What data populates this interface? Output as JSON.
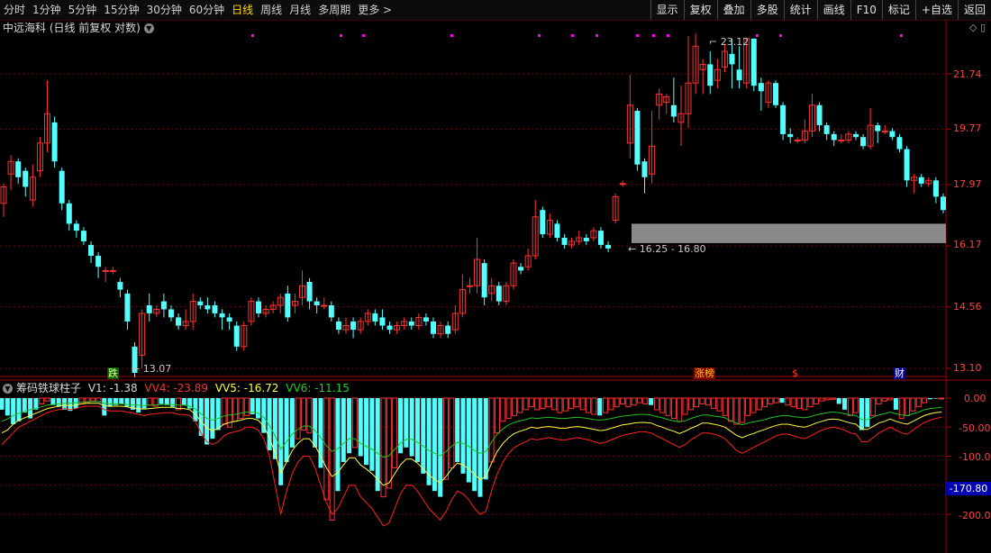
{
  "toolbar": {
    "left": [
      "分时",
      "1分钟",
      "5分钟",
      "15分钟",
      "30分钟",
      "60分钟",
      "日线",
      "周线",
      "月线",
      "多周期",
      "更多 >"
    ],
    "active_index": 6,
    "right": [
      "显示",
      "复权",
      "叠加",
      "多股",
      "统计",
      "画线",
      "F10",
      "标记",
      "+自选",
      "返回"
    ]
  },
  "header": {
    "title": "中远海科 (日线 前复权 对数)",
    "icons": "◇ ▯"
  },
  "price_axis": {
    "labels": [
      "21.74",
      "19.77",
      "17.97",
      "16.17",
      "14.56",
      "13.10"
    ]
  },
  "annotations": {
    "high": "23.12",
    "low": "13.07",
    "gap_zone": "16.25 - 16.80"
  },
  "markers": {
    "die": "跌",
    "zhangbang": "涨榜",
    "dollar": "$",
    "cai": "财"
  },
  "indicator": {
    "name": "筹码铁球柱子",
    "v1": "V1: -1.38",
    "vv4": "VV4: -23.89",
    "vv5": "VV5: -16.72",
    "vv6": "VV6: -11.15",
    "axis_labels": [
      "0.00",
      "-50.00",
      "-100.0",
      "-150.0",
      "-200.0"
    ],
    "current_badge": "-170.80"
  },
  "colors": {
    "up": "#ff3232",
    "down": "#54ffff",
    "grid": "#7a0000",
    "line_red": "#ff2020",
    "line_yellow": "#ffff40",
    "line_green": "#20c020",
    "marker_magenta": "#ff00ff"
  },
  "candles": [
    [
      17.4,
      17.9,
      17.1,
      18.0,
      17.0
    ],
    [
      18.3,
      18.7,
      18.0,
      18.9,
      17.8
    ],
    [
      18.7,
      18.2,
      18.1,
      18.8,
      18.0
    ],
    [
      18.4,
      17.9,
      17.7,
      18.5,
      17.6
    ],
    [
      17.5,
      18.2,
      17.4,
      18.6,
      17.3
    ],
    [
      18.4,
      19.3,
      18.3,
      19.5,
      18.2
    ],
    [
      19.3,
      20.3,
      19.2,
      21.5,
      19.0
    ],
    [
      20.0,
      18.7,
      18.6,
      20.2,
      18.5
    ],
    [
      18.4,
      17.4,
      17.3,
      18.5,
      17.2
    ],
    [
      17.4,
      16.8,
      16.7,
      17.5,
      16.6
    ],
    [
      16.8,
      16.6,
      16.5,
      16.9,
      16.4
    ],
    [
      16.6,
      16.3,
      16.2,
      16.7,
      16.2
    ],
    [
      16.2,
      15.9,
      15.8,
      16.3,
      15.7
    ],
    [
      15.9,
      15.6,
      15.5,
      16.0,
      15.3
    ],
    [
      15.5,
      15.5,
      15.4,
      15.6,
      15.2
    ],
    [
      15.5,
      15.5,
      15.4,
      15.6,
      15.4
    ],
    [
      15.2,
      15.0,
      14.9,
      15.3,
      14.8
    ],
    [
      14.9,
      14.2,
      14.1,
      15.0,
      14.0
    ],
    [
      13.6,
      13.0,
      12.9,
      13.7,
      12.9
    ],
    [
      13.4,
      14.4,
      13.2,
      14.5,
      13.1
    ],
    [
      14.6,
      14.4,
      14.3,
      14.9,
      14.2
    ],
    [
      14.4,
      14.5,
      14.3,
      14.6,
      14.3
    ],
    [
      14.7,
      14.5,
      14.4,
      14.9,
      14.3
    ],
    [
      14.5,
      14.3,
      14.2,
      14.6,
      14.2
    ],
    [
      14.3,
      14.1,
      14.0,
      14.4,
      14.0
    ],
    [
      14.1,
      14.2,
      14.0,
      14.5,
      14.0
    ],
    [
      14.2,
      14.7,
      14.1,
      14.9,
      14.0
    ],
    [
      14.7,
      14.6,
      14.5,
      14.8,
      14.5
    ],
    [
      14.6,
      14.5,
      14.4,
      14.8,
      14.4
    ],
    [
      14.6,
      14.4,
      14.3,
      14.7,
      14.3
    ],
    [
      14.4,
      14.3,
      14.1,
      14.5,
      14.0
    ],
    [
      14.3,
      14.2,
      14.1,
      14.4,
      14.0
    ],
    [
      14.1,
      13.6,
      13.5,
      14.2,
      13.5
    ],
    [
      13.6,
      14.1,
      13.5,
      14.2,
      13.5
    ],
    [
      14.2,
      14.7,
      14.1,
      14.8,
      14.1
    ],
    [
      14.7,
      14.4,
      14.3,
      14.8,
      14.3
    ],
    [
      14.4,
      14.5,
      14.3,
      14.6,
      14.3
    ],
    [
      14.5,
      14.6,
      14.4,
      14.7,
      14.4
    ],
    [
      14.6,
      14.8,
      14.5,
      14.9,
      14.4
    ],
    [
      14.9,
      14.3,
      14.2,
      15.1,
      14.2
    ],
    [
      14.6,
      14.7,
      14.4,
      14.9,
      14.4
    ],
    [
      14.8,
      15.1,
      14.6,
      15.5,
      14.6
    ],
    [
      15.2,
      14.7,
      14.6,
      15.3,
      14.5
    ],
    [
      14.7,
      14.6,
      14.5,
      14.8,
      14.4
    ],
    [
      14.6,
      14.6,
      14.5,
      14.8,
      14.5
    ],
    [
      14.6,
      14.3,
      14.2,
      14.7,
      14.2
    ],
    [
      14.2,
      14.0,
      13.9,
      14.3,
      13.9
    ],
    [
      14.0,
      14.1,
      13.9,
      14.3,
      13.9
    ],
    [
      14.2,
      14.0,
      13.9,
      14.3,
      13.8
    ],
    [
      14.0,
      14.2,
      13.9,
      14.3,
      13.9
    ],
    [
      14.2,
      14.4,
      14.1,
      14.5,
      14.1
    ],
    [
      14.4,
      14.2,
      14.1,
      14.5,
      14.1
    ],
    [
      14.3,
      14.1,
      14.0,
      14.5,
      14.0
    ],
    [
      14.1,
      14.0,
      13.9,
      14.2,
      13.9
    ],
    [
      14.0,
      14.1,
      13.9,
      14.2,
      13.9
    ],
    [
      14.1,
      14.2,
      14.0,
      14.3,
      14.0
    ],
    [
      14.2,
      14.1,
      14.0,
      14.3,
      14.0
    ],
    [
      14.1,
      14.3,
      14.0,
      14.4,
      14.0
    ],
    [
      14.3,
      14.2,
      14.1,
      14.4,
      14.1
    ],
    [
      14.2,
      13.9,
      13.8,
      14.3,
      13.8
    ],
    [
      13.9,
      14.1,
      13.8,
      14.2,
      13.8
    ],
    [
      14.1,
      13.9,
      13.8,
      14.2,
      13.8
    ],
    [
      14.0,
      14.4,
      13.9,
      14.6,
      13.9
    ],
    [
      14.4,
      15.0,
      14.3,
      15.4,
      14.3
    ],
    [
      15.1,
      15.1,
      14.9,
      15.3,
      14.9
    ],
    [
      15.1,
      15.8,
      15.0,
      16.4,
      14.9
    ],
    [
      15.7,
      14.8,
      14.7,
      15.8,
      14.6
    ],
    [
      14.9,
      15.1,
      14.7,
      15.3,
      14.7
    ],
    [
      15.1,
      14.7,
      14.6,
      15.2,
      14.6
    ],
    [
      14.7,
      15.1,
      14.6,
      15.2,
      14.6
    ],
    [
      15.1,
      15.7,
      15.0,
      15.8,
      15.0
    ],
    [
      15.6,
      15.5,
      15.4,
      15.7,
      15.4
    ],
    [
      15.6,
      15.9,
      15.5,
      16.1,
      15.5
    ],
    [
      15.9,
      17.0,
      15.8,
      17.5,
      15.8
    ],
    [
      17.2,
      16.5,
      16.4,
      17.3,
      16.4
    ],
    [
      16.5,
      16.9,
      16.4,
      17.1,
      16.4
    ],
    [
      16.8,
      16.4,
      16.3,
      16.9,
      16.3
    ],
    [
      16.4,
      16.2,
      16.1,
      16.5,
      16.1
    ],
    [
      16.2,
      16.3,
      16.1,
      16.4,
      16.1
    ],
    [
      16.3,
      16.4,
      16.2,
      16.6,
      16.2
    ],
    [
      16.4,
      16.3,
      16.2,
      16.5,
      16.2
    ],
    [
      16.4,
      16.6,
      16.3,
      16.7,
      16.3
    ],
    [
      16.6,
      16.2,
      16.1,
      16.7,
      16.1
    ],
    [
      16.2,
      16.1,
      16.0,
      16.3,
      16.0
    ],
    [
      16.9,
      17.6,
      16.8,
      17.7,
      16.8
    ],
    [
      18.0,
      18.0,
      17.9,
      18.1,
      17.9
    ],
    [
      19.3,
      20.6,
      19.1,
      21.7,
      18.8
    ],
    [
      20.4,
      18.6,
      18.5,
      20.5,
      18.4
    ],
    [
      18.7,
      18.2,
      18.1,
      18.8,
      17.7
    ],
    [
      18.3,
      19.2,
      18.1,
      20.4,
      18.0
    ],
    [
      20.6,
      21.0,
      20.3,
      21.2,
      20.1
    ],
    [
      20.7,
      20.9,
      20.6,
      21.0,
      20.3
    ],
    [
      20.6,
      20.2,
      20.1,
      21.6,
      20.0
    ],
    [
      20.0,
      20.3,
      19.8,
      21.3,
      19.2
    ],
    [
      20.3,
      21.4,
      20.1,
      23.2,
      19.8
    ],
    [
      21.4,
      22.8,
      21.2,
      23.3,
      21.0
    ],
    [
      21.9,
      22.1,
      21.8,
      22.3,
      21.0
    ],
    [
      22.1,
      21.3,
      21.1,
      22.6,
      21.0
    ],
    [
      21.5,
      21.9,
      21.3,
      22.3,
      21.2
    ],
    [
      22.0,
      22.6,
      21.9,
      22.9,
      21.8
    ],
    [
      22.5,
      22.1,
      21.9,
      23.1,
      21.2
    ],
    [
      21.9,
      21.5,
      21.3,
      22.8,
      21.2
    ],
    [
      21.4,
      23.1,
      21.3,
      23.1,
      21.2
    ],
    [
      23.1,
      21.3,
      21.2,
      23.1,
      21.1
    ],
    [
      21.4,
      21.1,
      21.0,
      21.6,
      20.4
    ],
    [
      20.7,
      21.4,
      20.6,
      21.5,
      20.5
    ],
    [
      21.4,
      20.6,
      20.5,
      21.5,
      20.5
    ],
    [
      20.6,
      19.6,
      19.5,
      20.7,
      19.4
    ],
    [
      19.6,
      19.5,
      19.4,
      19.8,
      19.3
    ],
    [
      19.4,
      19.4,
      19.3,
      19.5,
      19.3
    ],
    [
      19.4,
      19.7,
      19.3,
      20.1,
      19.3
    ],
    [
      19.7,
      20.6,
      19.5,
      21.0,
      19.5
    ],
    [
      20.6,
      19.9,
      19.8,
      20.7,
      19.7
    ],
    [
      19.9,
      19.6,
      19.5,
      20.0,
      19.4
    ],
    [
      19.6,
      19.4,
      19.3,
      19.7,
      19.2
    ],
    [
      19.4,
      19.4,
      19.3,
      19.6,
      19.3
    ],
    [
      19.4,
      19.6,
      19.3,
      19.7,
      19.3
    ],
    [
      19.6,
      19.5,
      19.4,
      19.7,
      19.4
    ],
    [
      19.5,
      19.2,
      19.1,
      19.6,
      19.1
    ],
    [
      19.2,
      19.9,
      19.1,
      20.5,
      19.1
    ],
    [
      19.9,
      19.7,
      19.6,
      20.0,
      19.3
    ],
    [
      19.7,
      19.7,
      19.6,
      19.9,
      19.6
    ],
    [
      19.7,
      19.5,
      19.4,
      19.8,
      19.4
    ],
    [
      19.5,
      19.1,
      19.0,
      19.6,
      19.0
    ],
    [
      19.1,
      18.1,
      18.0,
      19.2,
      17.9
    ],
    [
      18.1,
      18.2,
      18.0,
      18.3,
      17.7
    ],
    [
      18.2,
      18.0,
      17.9,
      18.3,
      17.9
    ],
    [
      18.0,
      18.1,
      17.9,
      18.2,
      17.9
    ],
    [
      18.1,
      17.6,
      17.5,
      18.2,
      17.4
    ],
    [
      17.6,
      17.2,
      17.1,
      17.7,
      17.1
    ]
  ],
  "indicator_data": {
    "bars": [
      -20,
      -30,
      -45,
      -40,
      -25,
      -35,
      -20,
      -10,
      -5,
      -12,
      -15,
      -20,
      -22,
      -18,
      -10,
      -8,
      -5,
      -6,
      -30,
      -15,
      -12,
      -10,
      -15,
      -20,
      -25,
      -18,
      -12,
      -14,
      -10,
      -12,
      -15,
      -20,
      -12,
      -18,
      -40,
      -65,
      -80,
      -70,
      -55,
      -45,
      -50,
      -40,
      -35,
      -30,
      -28,
      -35,
      -60,
      -90,
      -105,
      -150,
      -110,
      -85,
      -70,
      -55,
      -60,
      -85,
      -120,
      -175,
      -210,
      -160,
      -110,
      -95,
      -85,
      -100,
      -115,
      -125,
      -160,
      -170,
      -155,
      -120,
      -95,
      -85,
      -100,
      -110,
      -130,
      -150,
      -160,
      -170,
      -140,
      -120,
      -110,
      -130,
      -145,
      -160,
      -170,
      -140,
      -110,
      -60,
      -40,
      -35,
      -30,
      -25,
      -20,
      -15,
      -20,
      -18,
      -15,
      -20,
      -25,
      -22,
      -18,
      -15,
      -20,
      -25,
      -28,
      -30,
      -25,
      -20,
      -15,
      -10,
      -15,
      -12,
      -8,
      -10,
      -12,
      -20,
      -25,
      -30,
      -35,
      -40,
      -28,
      -20,
      -15,
      -10,
      -12,
      -18,
      -22,
      -30,
      -40,
      -45,
      -42,
      -30,
      -25,
      -20,
      -15,
      -10,
      -8,
      -8,
      -12,
      -15,
      -18,
      -20,
      -15,
      -10,
      -5,
      -3,
      -2,
      -10,
      -20,
      -30,
      -25,
      -55,
      -50,
      -30,
      -10,
      -5,
      -3,
      -20,
      -35,
      -30,
      -22,
      -15,
      -8,
      -2,
      -1,
      -1
    ],
    "cyan": [
      1,
      1,
      1,
      1,
      1,
      1,
      1,
      0,
      0,
      1,
      1,
      1,
      1,
      1,
      0,
      0,
      0,
      0,
      1,
      1,
      1,
      1,
      1,
      1,
      1,
      1,
      0,
      0,
      1,
      1,
      1,
      0,
      1,
      1,
      1,
      1,
      1,
      1,
      1,
      0,
      0,
      0,
      0,
      0,
      1,
      1,
      1,
      1,
      1,
      1,
      1,
      1,
      0,
      0,
      0,
      1,
      1,
      0,
      0,
      1,
      1,
      1,
      0,
      1,
      1,
      1,
      1,
      0,
      0,
      0,
      1,
      1,
      1,
      1,
      1,
      1,
      1,
      1,
      0,
      0,
      1,
      1,
      1,
      1,
      1,
      1,
      0,
      0,
      0,
      0,
      0,
      0,
      0,
      0,
      0,
      0,
      0,
      0,
      0,
      0,
      0,
      0,
      0,
      0,
      0,
      1,
      0,
      0,
      0,
      0,
      0,
      0,
      0,
      0,
      1,
      0,
      0,
      0,
      0,
      0,
      0,
      0,
      0,
      0,
      0,
      0,
      0,
      0,
      0,
      0,
      0,
      0,
      0,
      0,
      0,
      0,
      0,
      1,
      0,
      0,
      0,
      0,
      0,
      0,
      0,
      0,
      0,
      1,
      1,
      0,
      0,
      1,
      1,
      0,
      0,
      0,
      0,
      1,
      0,
      0,
      0,
      0,
      0,
      1,
      1,
      0,
      0
    ],
    "red": [
      -80,
      -70,
      -60,
      -50,
      -45,
      -40,
      -35,
      -30,
      -25,
      -22,
      -20,
      -18,
      -20,
      -18,
      -15,
      -14,
      -14,
      -14,
      -20,
      -22,
      -22,
      -22,
      -24,
      -26,
      -28,
      -30,
      -28,
      -27,
      -26,
      -25,
      -25,
      -28,
      -28,
      -30,
      -40,
      -60,
      -75,
      -80,
      -75,
      -65,
      -60,
      -58,
      -55,
      -50,
      -50,
      -55,
      -70,
      -100,
      -150,
      -200,
      -160,
      -130,
      -110,
      -100,
      -100,
      -120,
      -150,
      -180,
      -200,
      -190,
      -170,
      -150,
      -150,
      -170,
      -180,
      -190,
      -205,
      -220,
      -215,
      -190,
      -165,
      -150,
      -150,
      -160,
      -175,
      -190,
      -200,
      -210,
      -195,
      -175,
      -160,
      -165,
      -175,
      -190,
      -200,
      -195,
      -160,
      -130,
      -110,
      -95,
      -85,
      -80,
      -75,
      -70,
      -72,
      -70,
      -68,
      -70,
      -72,
      -72,
      -70,
      -68,
      -70,
      -72,
      -75,
      -78,
      -76,
      -72,
      -68,
      -64,
      -62,
      -60,
      -58,
      -58,
      -60,
      -65,
      -70,
      -75,
      -80,
      -85,
      -80,
      -72,
      -66,
      -60,
      -60,
      -62,
      -65,
      -70,
      -80,
      -90,
      -95,
      -90,
      -85,
      -80,
      -75,
      -70,
      -65,
      -62,
      -62,
      -65,
      -68,
      -70,
      -65,
      -60,
      -55,
      -52,
      -50,
      -52,
      -55,
      -60,
      -62,
      -75,
      -75,
      -68,
      -60,
      -55,
      -50,
      -55,
      -60,
      -62,
      -55,
      -48,
      -42,
      -38,
      -35,
      -33
    ],
    "yellow": [
      -60,
      -55,
      -45,
      -38,
      -34,
      -30,
      -26,
      -22,
      -18,
      -16,
      -14,
      -12,
      -13,
      -12,
      -10,
      -9,
      -9,
      -9,
      -13,
      -14,
      -14,
      -14,
      -15,
      -17,
      -18,
      -19,
      -18,
      -17,
      -16,
      -16,
      -16,
      -18,
      -18,
      -20,
      -28,
      -40,
      -52,
      -56,
      -52,
      -45,
      -42,
      -40,
      -38,
      -35,
      -35,
      -38,
      -48,
      -68,
      -95,
      -130,
      -110,
      -90,
      -78,
      -70,
      -70,
      -82,
      -100,
      -120,
      -135,
      -128,
      -115,
      -103,
      -103,
      -115,
      -122,
      -130,
      -140,
      -150,
      -146,
      -130,
      -115,
      -105,
      -105,
      -112,
      -122,
      -132,
      -140,
      -146,
      -135,
      -122,
      -112,
      -115,
      -122,
      -132,
      -140,
      -135,
      -112,
      -92,
      -78,
      -68,
      -61,
      -57,
      -54,
      -50,
      -52,
      -50,
      -49,
      -50,
      -52,
      -52,
      -50,
      -49,
      -50,
      -52,
      -54,
      -56,
      -55,
      -52,
      -49,
      -46,
      -45,
      -43,
      -42,
      -42,
      -43,
      -47,
      -50,
      -54,
      -57,
      -61,
      -57,
      -52,
      -48,
      -43,
      -43,
      -45,
      -47,
      -50,
      -57,
      -64,
      -68,
      -64,
      -61,
      -57,
      -54,
      -50,
      -47,
      -45,
      -45,
      -47,
      -49,
      -50,
      -47,
      -43,
      -40,
      -37,
      -36,
      -37,
      -40,
      -43,
      -45,
      -54,
      -54,
      -49,
      -43,
      -40,
      -36,
      -40,
      -43,
      -45,
      -40,
      -35,
      -30,
      -27,
      -25,
      -24
    ],
    "green": [
      -40,
      -36,
      -30,
      -26,
      -23,
      -20,
      -18,
      -15,
      -12,
      -11,
      -10,
      -9,
      -9,
      -8,
      -7,
      -6,
      -6,
      -6,
      -9,
      -10,
      -10,
      -10,
      -11,
      -12,
      -12,
      -13,
      -12,
      -12,
      -11,
      -11,
      -11,
      -12,
      -12,
      -14,
      -19,
      -27,
      -35,
      -38,
      -35,
      -31,
      -29,
      -28,
      -26,
      -24,
      -24,
      -26,
      -33,
      -47,
      -65,
      -88,
      -75,
      -62,
      -54,
      -48,
      -48,
      -56,
      -68,
      -82,
      -92,
      -87,
      -78,
      -70,
      -70,
      -78,
      -83,
      -88,
      -95,
      -102,
      -99,
      -88,
      -78,
      -71,
      -71,
      -76,
      -83,
      -90,
      -95,
      -99,
      -92,
      -83,
      -76,
      -78,
      -83,
      -90,
      -95,
      -92,
      -76,
      -62,
      -53,
      -46,
      -42,
      -39,
      -37,
      -34,
      -35,
      -34,
      -33,
      -34,
      -35,
      -35,
      -34,
      -33,
      -34,
      -35,
      -37,
      -38,
      -37,
      -35,
      -33,
      -31,
      -30,
      -29,
      -28,
      -28,
      -29,
      -32,
      -34,
      -37,
      -39,
      -41,
      -39,
      -35,
      -32,
      -29,
      -29,
      -31,
      -32,
      -34,
      -39,
      -43,
      -46,
      -43,
      -41,
      -39,
      -37,
      -34,
      -32,
      -30,
      -30,
      -32,
      -33,
      -34,
      -32,
      -29,
      -27,
      -25,
      -24,
      -25,
      -27,
      -29,
      -30,
      -37,
      -37,
      -33,
      -29,
      -27,
      -24,
      -27,
      -29,
      -30,
      -27,
      -24,
      -20,
      -18,
      -17,
      -16
    ]
  }
}
